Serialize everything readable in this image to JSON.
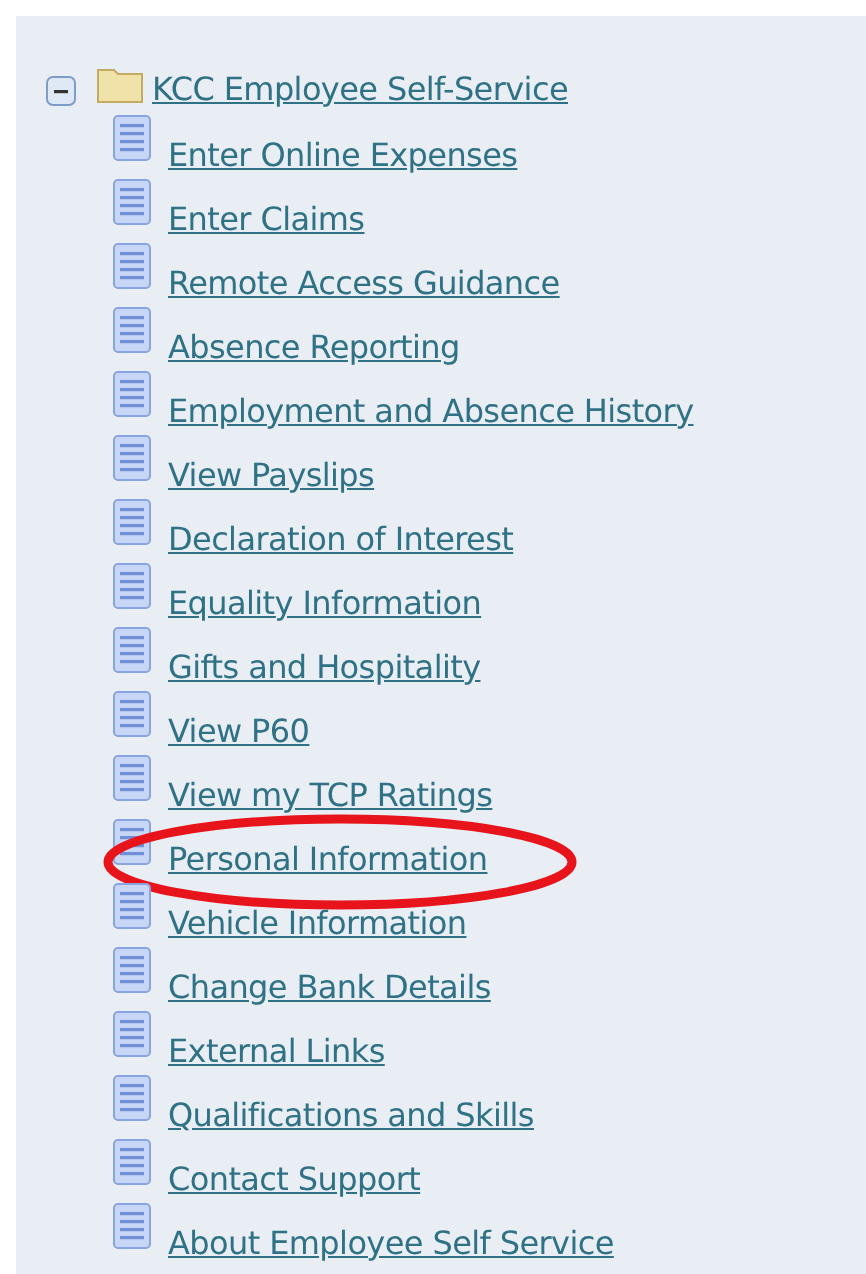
{
  "tree": {
    "label": "KCC Employee Self-Service",
    "expanded": true,
    "children": [
      {
        "label": "Enter Online Expenses",
        "circled": false
      },
      {
        "label": "Enter Claims",
        "circled": false
      },
      {
        "label": "Remote Access Guidance",
        "circled": false
      },
      {
        "label": "Absence Reporting",
        "circled": false
      },
      {
        "label": "Employment and Absence History",
        "circled": false
      },
      {
        "label": "View Payslips",
        "circled": false
      },
      {
        "label": "Declaration of Interest",
        "circled": false
      },
      {
        "label": "Equality Information",
        "circled": false
      },
      {
        "label": "Gifts and Hospitality",
        "circled": false
      },
      {
        "label": "View P60",
        "circled": false
      },
      {
        "label": "View my TCP Ratings",
        "circled": false
      },
      {
        "label": "Personal Information",
        "circled": true
      },
      {
        "label": "Vehicle Information",
        "circled": false
      },
      {
        "label": "Change Bank Details",
        "circled": false
      },
      {
        "label": "External Links",
        "circled": false
      },
      {
        "label": "Qualifications and Skills",
        "circled": false
      },
      {
        "label": "Contact Support",
        "circled": false
      },
      {
        "label": "About Employee Self Service",
        "circled": false
      }
    ]
  }
}
